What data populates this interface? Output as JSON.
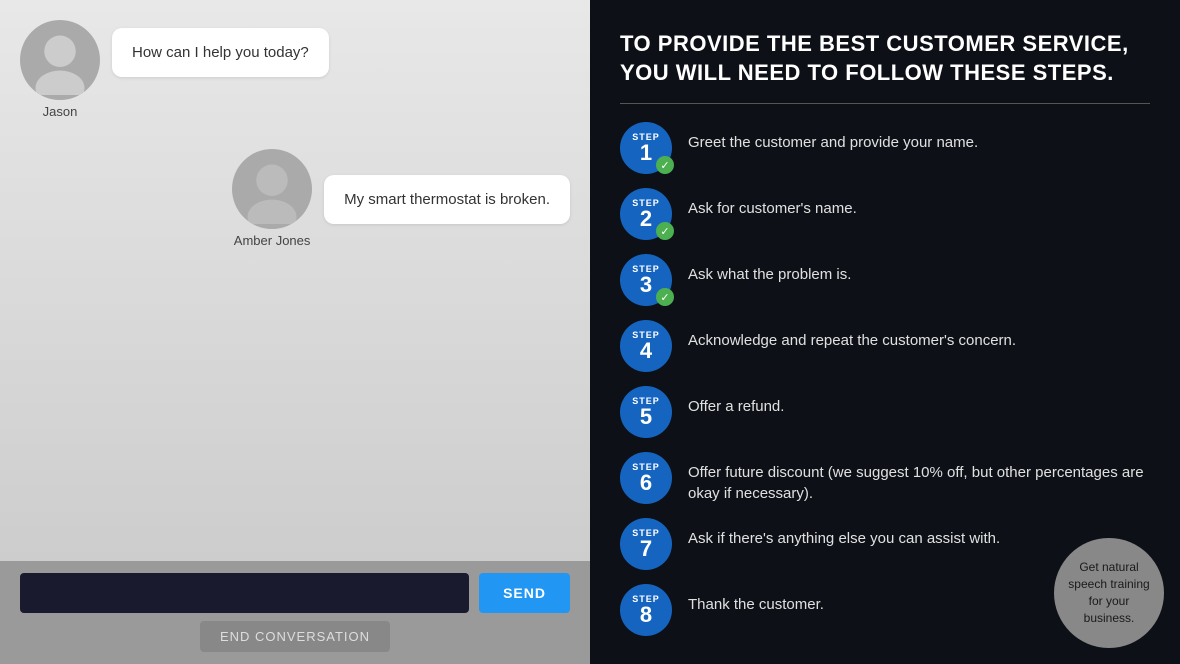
{
  "left": {
    "jason": {
      "name": "Jason",
      "message": "How can I help you today?"
    },
    "amber": {
      "name": "Amber Jones",
      "message": "My smart thermostat is broken."
    },
    "input": {
      "placeholder": "",
      "send_label": "SEND",
      "end_label": "END CONVERSATION"
    }
  },
  "right": {
    "title_line1": "TO PROVIDE THE BEST CUSTOMER SERVICE,",
    "title_line2": "YOU WILL NEED TO FOLLOW THESE STEPS.",
    "steps": [
      {
        "number": "1",
        "text": "Greet the customer and provide your name.",
        "checked": true
      },
      {
        "number": "2",
        "text": "Ask for customer's name.",
        "checked": true
      },
      {
        "number": "3",
        "text": "Ask what the problem is.",
        "checked": true
      },
      {
        "number": "4",
        "text": "Acknowledge and repeat the customer's concern.",
        "checked": false
      },
      {
        "number": "5",
        "text": "Offer a refund.",
        "checked": false
      },
      {
        "number": "6",
        "text": "Offer future discount (we suggest 10% off, but other percentages are okay if necessary).",
        "checked": false
      },
      {
        "number": "7",
        "text": "Ask if there's anything else you can assist with.",
        "checked": false
      },
      {
        "number": "8",
        "text": "Thank the customer.",
        "checked": false
      }
    ],
    "branding": "Get natural speech training for your business."
  }
}
